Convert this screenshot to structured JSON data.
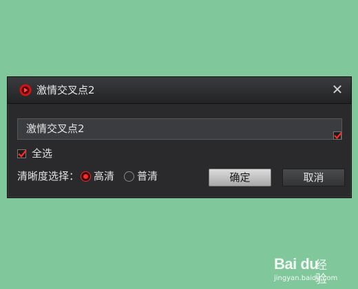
{
  "dialog": {
    "title": "激情交叉点2",
    "close_glyph": "✕",
    "name_value": "激情交叉点2",
    "name_checked": true,
    "select_all": {
      "label": "全选",
      "checked": true
    },
    "quality": {
      "label": "清晰度选择：",
      "options": [
        {
          "label": "高清",
          "selected": true
        },
        {
          "label": "普清",
          "selected": false
        }
      ]
    },
    "buttons": {
      "ok": "确定",
      "cancel": "取消"
    },
    "icons": {
      "logo": "player-logo-icon",
      "close": "close-icon",
      "check": "checkmark-icon"
    },
    "colors": {
      "accent": "#ff2a2a",
      "background": "#80c79c",
      "dialog": "#2a2a2c"
    }
  },
  "watermark": {
    "brand": "Bai du",
    "sub": "经验",
    "url": "jingyan.baidu.com"
  }
}
